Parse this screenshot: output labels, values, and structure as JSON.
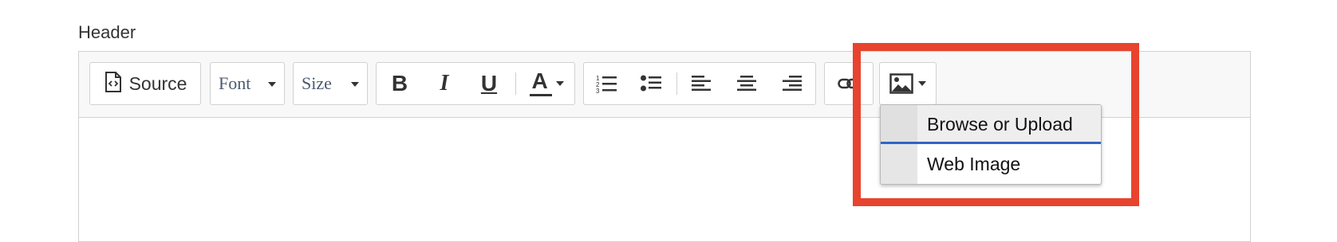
{
  "field": {
    "label": "Header"
  },
  "toolbar": {
    "source_label": "Source",
    "font_label": "Font",
    "size_label": "Size",
    "bold_glyph": "B",
    "italic_glyph": "I",
    "underline_glyph": "U",
    "text_color_glyph": "A"
  },
  "image_menu": {
    "items": [
      {
        "label": "Browse or Upload",
        "state": "hovered"
      },
      {
        "label": "Web Image"
      }
    ]
  },
  "colors": {
    "annotation_highlight": "#e8432e",
    "menu_hover_underline": "#2f66c6",
    "toolbar_bg": "#f8f8f8",
    "border": "#d1d1d1"
  }
}
